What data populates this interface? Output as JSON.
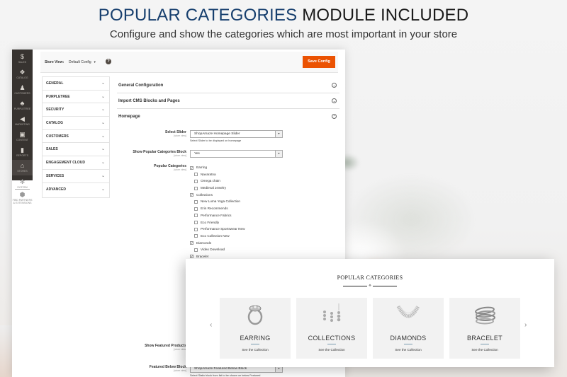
{
  "header": {
    "title_accent": "POPULAR CATEGORIES",
    "title_rest": " MODULE INCLUDED",
    "subtitle": "Configure and show the categories which are most important in your store"
  },
  "admin": {
    "sidebar": [
      {
        "label": "Sales",
        "icon": "dollar-icon"
      },
      {
        "label": "Catalog",
        "icon": "box-icon"
      },
      {
        "label": "Customers",
        "icon": "person-icon"
      },
      {
        "label": "Purpletree",
        "icon": "tree-icon"
      },
      {
        "label": "Marketing",
        "icon": "megaphone-icon"
      },
      {
        "label": "Content",
        "icon": "layout-icon"
      },
      {
        "label": "Reports",
        "icon": "bar-chart-icon"
      },
      {
        "label": "Stores",
        "icon": "store-icon",
        "active": true
      },
      {
        "label": "System",
        "icon": "gear-icon"
      },
      {
        "label": "Find Partners & Extensions",
        "icon": "cube-icon"
      }
    ],
    "store_view": {
      "label": "Store View:",
      "value": "Default Config"
    },
    "save_button": "Save Config",
    "config_tabs": [
      "General",
      "Purpletree",
      "Security",
      "Catalog",
      "Customers",
      "Sales",
      "Engagement Cloud",
      "Services",
      "Advanced"
    ],
    "sections": [
      {
        "title": "General Configuration",
        "state": "collapsed"
      },
      {
        "title": "Import CMS Blocks and Pages",
        "state": "collapsed"
      },
      {
        "title": "Homepage",
        "state": "expanded"
      }
    ],
    "scope_label": "[store view]",
    "fields": {
      "select_slider": {
        "label": "Select Slider",
        "value": "ShopAmaze Homepage Slider",
        "note": "Select Slider to be displayed on homepage"
      },
      "show_popular": {
        "label": "Show Popular Categories Block",
        "value": "Yes"
      },
      "popular_categories": {
        "label": "Popular Categories",
        "options": [
          {
            "label": "Earring",
            "checked": true,
            "level": 0
          },
          {
            "label": "Navaratna",
            "checked": false,
            "level": 1
          },
          {
            "label": "Omega chain",
            "checked": false,
            "level": 1
          },
          {
            "label": "Medieval Jewelry",
            "checked": false,
            "level": 1
          },
          {
            "label": "Collections",
            "checked": true,
            "level": 0
          },
          {
            "label": "New Luma Yoga Collection",
            "checked": false,
            "level": 1
          },
          {
            "label": "Erin Recommends",
            "checked": false,
            "level": 1
          },
          {
            "label": "Performance Fabrics",
            "checked": false,
            "level": 1
          },
          {
            "label": "Eco Friendly",
            "checked": false,
            "level": 1
          },
          {
            "label": "Performance Sportswear New",
            "checked": false,
            "level": 1
          },
          {
            "label": "Eco Collection New",
            "checked": false,
            "level": 1
          },
          {
            "label": "Diamonds",
            "checked": true,
            "level": 0
          },
          {
            "label": "Video Download",
            "checked": false,
            "level": 1
          },
          {
            "label": "Bracelet",
            "checked": true,
            "level": 0
          }
        ]
      },
      "show_featured": {
        "label": "Show Featured Products"
      },
      "featured_below": {
        "label": "Featured Below Block",
        "value": "ShopAmaze Featured Below Block",
        "note": "Select Static block from list to be shown on below Featured"
      }
    }
  },
  "frontend": {
    "title": "POPULAR CATEGORIES",
    "prev_icon": "‹",
    "next_icon": "›",
    "cards": [
      {
        "name": "EARRING",
        "link": "See the Collection",
        "image": "ring-image"
      },
      {
        "name": "COLLECTIONS",
        "link": "See the Collection",
        "image": "jewelry-set-image"
      },
      {
        "name": "DIAMONDS",
        "link": "See the Collection",
        "image": "necklace-image"
      },
      {
        "name": "BRACELET",
        "link": "See the Collection",
        "image": "bracelets-image"
      }
    ]
  }
}
